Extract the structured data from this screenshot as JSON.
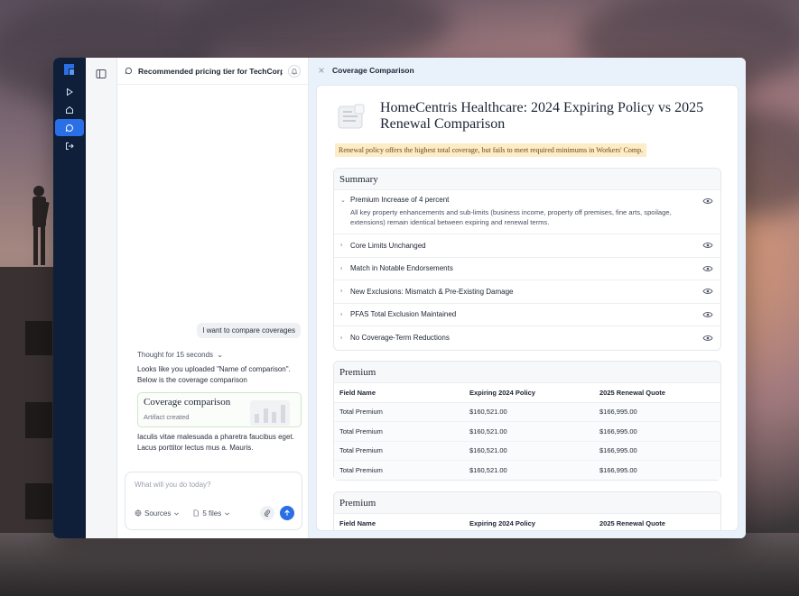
{
  "chat": {
    "title": "Recommended pricing tier for TechCorp",
    "user_message": "I want to compare coverages",
    "thought": "Thought for 15 seconds",
    "thought_chevron": "⌄",
    "reply": "Looks like you uploaded \"Name of comparison\". Below is the coverage comparison",
    "artifact": {
      "title": "Coverage comparison",
      "subtitle": "Artifact created"
    },
    "reply2": "Iaculis vitae malesuada a pharetra faucibus eget. Lacus porttitor lectus mus a. Mauris.",
    "composer": {
      "placeholder": "What will you do today?",
      "sources_label": "Sources",
      "files_label": "5 files"
    }
  },
  "panel": {
    "title": "Coverage Comparison",
    "doc_title": "HomeCentris Healthcare: 2024 Expiring Policy vs 2025 Renewal Comparison",
    "callout": "Renewal policy offers the highest total coverage, but fails to meet required minimums in Workers' Comp.",
    "summary": {
      "heading": "Summary",
      "items": [
        {
          "label": "Premium Increase of 4 percent",
          "desc": "All key property enhancements and sub-limits (business income, property off premises, fine arts, spoilage, extensions) remain identical between expiring and renewal terms."
        },
        {
          "label": "Core Limits Unchanged"
        },
        {
          "label": "Match in Notable Endorsements"
        },
        {
          "label": "New Exclusions: Mismatch & Pre-Existing Damage"
        },
        {
          "label": "PFAS Total Exclusion Maintained"
        },
        {
          "label": "No Coverage-Term Reductions"
        }
      ]
    },
    "premium1": {
      "heading": "Premium",
      "columns": [
        "Field Name",
        "Expiring 2024 Policy",
        "2025 Renewal Quote"
      ],
      "rows": [
        [
          "Total Premium",
          "$160,521.00",
          "$166,995.00"
        ],
        [
          "Total Premium",
          "$160,521.00",
          "$166,995.00"
        ],
        [
          "Total Premium",
          "$160,521.00",
          "$166,995.00"
        ],
        [
          "Total Premium",
          "$160,521.00",
          "$166,995.00"
        ]
      ]
    },
    "premium2": {
      "heading": "Premium",
      "columns": [
        "Field Name",
        "Expiring 2024 Policy",
        "2025 Renewal Quote"
      ]
    }
  },
  "colors": {
    "rail": "#0f1f3a",
    "accent": "#2b6fe6",
    "callout_bg": "#fdecc8"
  }
}
